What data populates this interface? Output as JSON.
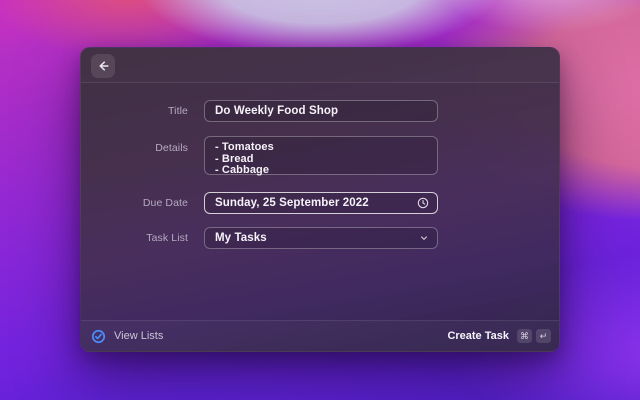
{
  "form": {
    "fields": [
      {
        "label": "Title",
        "value": "Do Weekly Food Shop"
      },
      {
        "label": "Details",
        "value": "- Tomatoes\n- Bread\n- Cabbage"
      },
      {
        "label": "Due Date",
        "value": "Sunday, 25 September 2022"
      },
      {
        "label": "Task List",
        "value": "My Tasks"
      }
    ]
  },
  "footer": {
    "view_lists": "View Lists",
    "create_task": "Create Task",
    "shortcuts": [
      "⌘",
      "↵"
    ]
  },
  "colors": {
    "accent_blue": "#4b8bf5",
    "focused_field_border": "rgba(255,255,255,0.78)",
    "window_base": "#43304a"
  }
}
